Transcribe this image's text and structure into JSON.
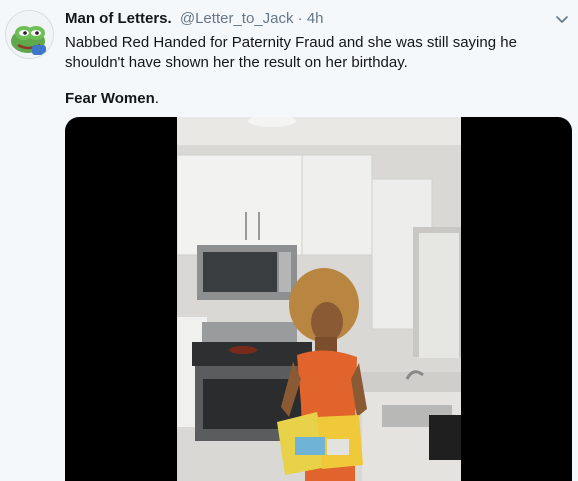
{
  "tweet": {
    "display_name": "Man of Letters.",
    "handle": "@Letter_to_Jack",
    "separator": "·",
    "time": "4h",
    "text_line1": "Nabbed Red Handed for Paternity Fraud and she was still saying he shouldn't have shown her the result on her birthday.",
    "text_bold": "Fear Women",
    "text_after_bold": "."
  },
  "icons": {
    "avatar": "pepe-frog-avatar",
    "menu": "chevron-down-icon"
  },
  "colors": {
    "background": "#f5f8fa",
    "secondary_text": "#657786",
    "video_background": "#000000"
  }
}
